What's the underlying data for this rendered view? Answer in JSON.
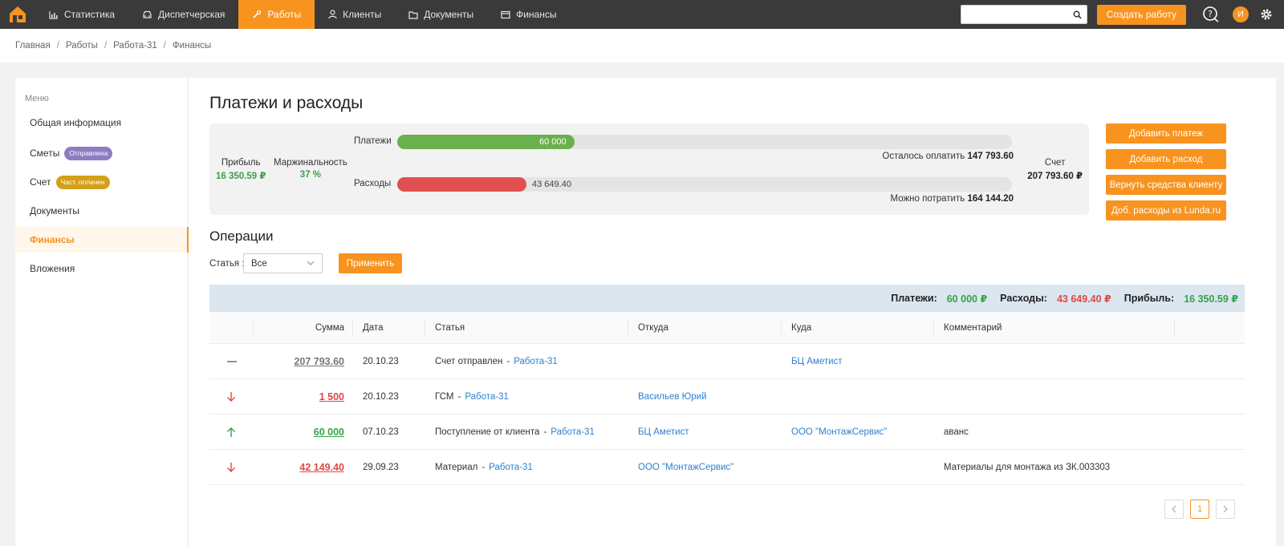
{
  "nav": {
    "items": [
      {
        "label": "Статистика",
        "icon": "chart-icon"
      },
      {
        "label": "Диспетчерская",
        "icon": "car-icon"
      },
      {
        "label": "Работы",
        "icon": "wrench-icon",
        "active": true
      },
      {
        "label": "Клиенты",
        "icon": "user-icon"
      },
      {
        "label": "Документы",
        "icon": "folder-icon"
      },
      {
        "label": "Финансы",
        "icon": "wallet-icon"
      }
    ],
    "search_value": "",
    "create_label": "Создать работу",
    "avatar_letter": "И"
  },
  "breadcrumbs": [
    "Главная",
    "Работы",
    "Работа-31",
    "Финансы"
  ],
  "sidebar": {
    "title": "Меню",
    "items": [
      {
        "label": "Общая информация"
      },
      {
        "label": "Сметы",
        "badge": "Отправлена",
        "badge_color": "#8e7cc3"
      },
      {
        "label": "Счет",
        "badge": "Част. оплачен",
        "badge_color": "#d4a017"
      },
      {
        "label": "Документы"
      },
      {
        "label": "Финансы",
        "active": true
      },
      {
        "label": "Вложения"
      }
    ]
  },
  "page_title": "Платежи и расходы",
  "summary": {
    "profit_label": "Прибыль",
    "profit_value": "16 350.59 ₽",
    "margin_label": "Маржинальность",
    "margin_value": "37 %",
    "payments_label": "Платежи",
    "payments_value": "60 000",
    "payments_fraction": 0.289,
    "remaining_label": "Осталось оплатить",
    "remaining_value": "147 793.60",
    "expenses_label": "Расходы",
    "expenses_value": "43 649.40",
    "expenses_fraction": 0.21,
    "can_spend_label": "Можно потратить",
    "can_spend_value": "164 144.20",
    "invoice_label": "Счет",
    "invoice_value": "207 793.60 ₽"
  },
  "actions": [
    "Добавить платеж",
    "Добавить расход",
    "Вернуть средства клиенту",
    "Доб. расходы из Lunda.ru"
  ],
  "operations": {
    "title": "Операции",
    "filter_label": "Статья :",
    "filter_value": "Все",
    "apply_label": "Применить",
    "totals": {
      "payments_label": "Платежи:",
      "payments_value": "60 000 ₽",
      "expenses_label": "Расходы:",
      "expenses_value": "43 649.40 ₽",
      "profit_label": "Прибыль:",
      "profit_value": "16 350.59 ₽"
    },
    "columns": [
      "Сумма",
      "Дата",
      "Статья",
      "Откуда",
      "Куда",
      "Комментарий"
    ],
    "rows": [
      {
        "type": "neutral",
        "amount": "207 793.60",
        "color": "#777777",
        "date": "20.10.23",
        "article": "Счет отправлен",
        "article_link": "Работа-31",
        "from": "",
        "to": "БЦ Аметист",
        "comment": ""
      },
      {
        "type": "down",
        "amount": "1 500",
        "color": "#e04848",
        "date": "20.10.23",
        "article": "ГСМ",
        "article_link": "Работа-31",
        "from": "Васильев Юрий",
        "to": "",
        "comment": ""
      },
      {
        "type": "up",
        "amount": "60 000",
        "color": "#3aa04a",
        "date": "07.10.23",
        "article": "Поступление от клиента",
        "article_link": "Работа-31",
        "from": "БЦ Аметист",
        "to": "ООО \"МонтажСервис\"",
        "comment": "аванс"
      },
      {
        "type": "down",
        "amount": "42 149.40",
        "color": "#e04848",
        "date": "29.09.23",
        "article": "Материал",
        "article_link": "Работа-31",
        "from": "ООО \"МонтажСервис\"",
        "to": "",
        "comment": "Материалы для монтажа из ЗК.003303"
      }
    ],
    "current_page": "1"
  },
  "colors": {
    "accent": "#f7931e",
    "green": "#6ab04c",
    "red": "#e05050",
    "link": "#2f7fd0"
  }
}
